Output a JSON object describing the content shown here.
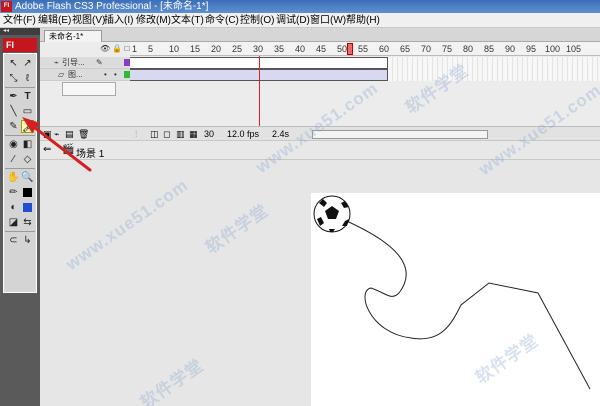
{
  "window": {
    "title": "Adobe Flash CS3 Professional - [未命名-1*]",
    "logo": "Fl"
  },
  "menu": [
    "文件(F)",
    "编辑(E)",
    "视图(V)",
    "插入(I)",
    "修改(M)",
    "文本(T)",
    "命令(C)",
    "控制(O)",
    "调试(D)",
    "窗口(W)",
    "帮助(H)"
  ],
  "tools": {
    "panel_logo": "Fl",
    "collapse": "◂◂",
    "selected_tool": "brush-tool"
  },
  "document": {
    "tab": "未命名-1*"
  },
  "timeline": {
    "ruler_ticks": [
      "1",
      "5",
      "10",
      "15",
      "20",
      "25",
      "30",
      "35",
      "40",
      "45",
      "50",
      "55",
      "60",
      "65",
      "70",
      "75",
      "80",
      "85",
      "90",
      "95",
      "100",
      "105"
    ],
    "layers": [
      {
        "name": "引导..."
      },
      {
        "name": "图..."
      }
    ],
    "current_frame": "30",
    "frame_rate": "12.0 fps",
    "elapsed_time": "2.4s"
  },
  "scene": {
    "label": "场景 1"
  },
  "watermark": {
    "text": "软件学堂",
    "url": "www.xue51.com"
  },
  "colors": {
    "title_bar": "#3b6fb6",
    "flash_red": "#c4161c",
    "playhead": "#d22222",
    "stage": "#ffffff",
    "annotation_arrow": "#d62020"
  }
}
